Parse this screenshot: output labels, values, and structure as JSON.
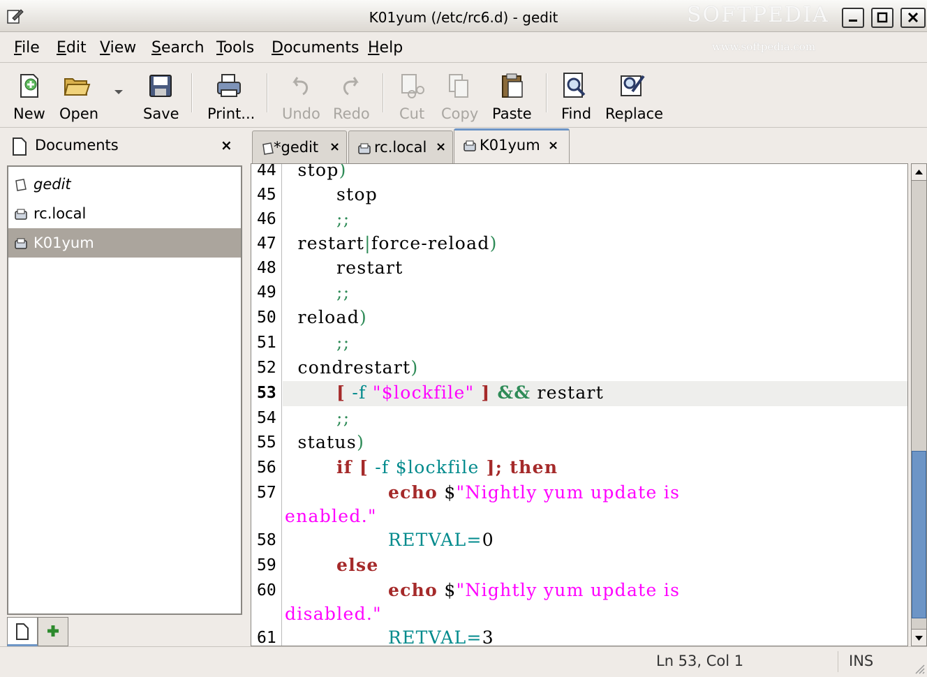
{
  "window": {
    "title": "K01yum (/etc/rc6.d) - gedit",
    "watermark": "SOFTPEDIA",
    "watermark_url": "www.softpedia.com"
  },
  "menubar": {
    "items": [
      {
        "label": "File",
        "key": "F",
        "rest": "ile"
      },
      {
        "label": "Edit",
        "key": "E",
        "rest": "dit"
      },
      {
        "label": "View",
        "key": "V",
        "rest": "iew"
      },
      {
        "label": "Search",
        "key": "S",
        "rest": "earch"
      },
      {
        "label": "Tools",
        "key": "T",
        "rest": "ools"
      },
      {
        "label": "Documents",
        "key": "D",
        "rest": "ocuments"
      },
      {
        "label": "Help",
        "key": "H",
        "rest": "elp"
      }
    ]
  },
  "toolbar": {
    "new": "New",
    "open": "Open",
    "save": "Save",
    "print": "Print...",
    "undo": "Undo",
    "redo": "Redo",
    "cut": "Cut",
    "copy": "Copy",
    "paste": "Paste",
    "find": "Find",
    "replace": "Replace"
  },
  "side_pane": {
    "title": "Documents",
    "close": "×",
    "documents": [
      {
        "name": "gedit",
        "italic": true,
        "selected": false
      },
      {
        "name": "rc.local",
        "italic": false,
        "selected": false
      },
      {
        "name": "K01yum",
        "italic": false,
        "selected": true
      }
    ]
  },
  "tabs": [
    {
      "label": "*gedit",
      "active": false
    },
    {
      "label": "rc.local",
      "active": false
    },
    {
      "label": "K01yum",
      "active": true
    }
  ],
  "tab_close": "×",
  "editor": {
    "current_line": 53,
    "line_numbers": [
      "44",
      "45",
      "46",
      "47",
      "48",
      "49",
      "50",
      "51",
      "52",
      "53",
      "54",
      "55",
      "56",
      "57",
      "",
      "58",
      "59",
      "60",
      "",
      "61"
    ],
    "code": {
      "l44a": "  stop",
      "l44b": ")",
      "l45": "        stop",
      "l46": "        ;;",
      "l47a": "  restart",
      "l47b": "|",
      "l47c": "force-reload",
      "l47d": ")",
      "l48": "        restart",
      "l49": "        ;;",
      "l50a": "  reload",
      "l50b": ")",
      "l51": "        ;;",
      "l52a": "  condrestart",
      "l52b": ")",
      "l53a": "        ",
      "l53b": "[",
      "l53c": " -f ",
      "l53d": "\"$lockfile\"",
      "l53e": " ]",
      "l53f": " &&",
      "l53g": " restart",
      "l54": "        ;;",
      "l55a": "  status",
      "l55b": ")",
      "l56a": "        ",
      "l56b": "if",
      "l56c": " [",
      "l56d": " -f $lockfile",
      "l56e": " ];",
      "l56f": " then",
      "l57a": "                ",
      "l57b": "echo",
      "l57c": " $",
      "l57d": "\"Nightly yum update is",
      "l57e": "enabled.\"",
      "l58a": "                ",
      "l58b": "RETVAL=",
      "l58c": "0",
      "l59a": "        ",
      "l59b": "else",
      "l60a": "                ",
      "l60b": "echo",
      "l60c": " $",
      "l60d": "\"Nightly yum update is",
      "l60e": "disabled.\"",
      "l61a": "                ",
      "l61b": "RETVAL=",
      "l61c": "3"
    }
  },
  "statusbar": {
    "position": "Ln 53, Col 1",
    "mode": "INS"
  },
  "colors": {
    "keyword": "#a52a2a",
    "operator": "#2e8b57",
    "variable": "#008a8c",
    "string": "#ff00ff",
    "accent": "#6d95c6"
  }
}
